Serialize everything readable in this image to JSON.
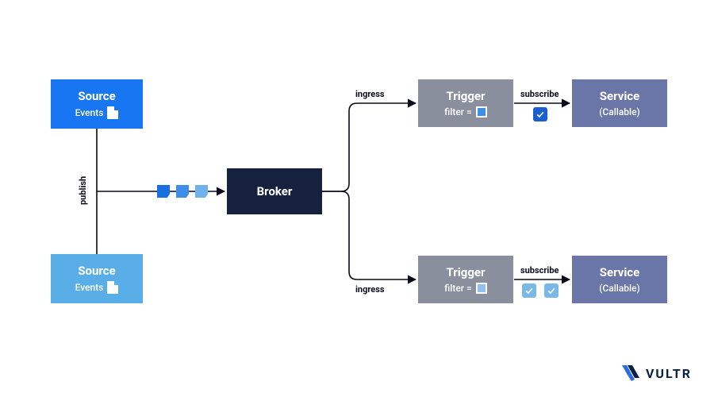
{
  "nodes": {
    "source1": {
      "title": "Source",
      "sub": "Events"
    },
    "source2": {
      "title": "Source",
      "sub": "Events"
    },
    "broker": {
      "title": "Broker"
    },
    "trigger1": {
      "title": "Trigger",
      "sub": "filter ="
    },
    "trigger2": {
      "title": "Trigger",
      "sub": "filter ="
    },
    "service1": {
      "title": "Service",
      "sub": "(Callable)"
    },
    "service2": {
      "title": "Service",
      "sub": "(Callable)"
    }
  },
  "labels": {
    "publish": "publish",
    "ingress1": "ingress",
    "ingress2": "ingress",
    "subscribe1": "subscribe",
    "subscribe2": "subscribe"
  },
  "colors": {
    "sourceDark": "#1976f2",
    "sourceLight": "#5aaee8",
    "broker": "#16213e",
    "trigger": "#8a8f9e",
    "service": "#6b76a8",
    "packetDark": "#1a6fe0",
    "packetMid": "#3c8ee8",
    "packetLight": "#6fb1ea",
    "filterTop": "#3c8ee8",
    "filterBottom": "#8fc2ef",
    "checkBlue": "#1a5fd0",
    "checkLight": "#7ab8e8"
  },
  "logo": {
    "text": "VULTR"
  },
  "chart_data": {
    "type": "flow-diagram",
    "nodes": [
      {
        "id": "source1",
        "label": "Source",
        "sublabel": "Events",
        "kind": "source"
      },
      {
        "id": "source2",
        "label": "Source",
        "sublabel": "Events",
        "kind": "source"
      },
      {
        "id": "broker",
        "label": "Broker",
        "kind": "broker"
      },
      {
        "id": "trigger1",
        "label": "Trigger",
        "sublabel": "filter =",
        "kind": "trigger",
        "filterColor": "#3c8ee8"
      },
      {
        "id": "trigger2",
        "label": "Trigger",
        "sublabel": "filter =",
        "kind": "trigger",
        "filterColor": "#8fc2ef"
      },
      {
        "id": "service1",
        "label": "Service",
        "sublabel": "(Callable)",
        "kind": "service"
      },
      {
        "id": "service2",
        "label": "Service",
        "sublabel": "(Callable)",
        "kind": "service"
      }
    ],
    "edges": [
      {
        "from": "source1",
        "to": "broker",
        "label": "publish"
      },
      {
        "from": "source2",
        "to": "broker",
        "label": "publish"
      },
      {
        "from": "broker",
        "to": "trigger1",
        "label": "ingress"
      },
      {
        "from": "broker",
        "to": "trigger2",
        "label": "ingress"
      },
      {
        "from": "trigger1",
        "to": "service1",
        "label": "subscribe"
      },
      {
        "from": "trigger2",
        "to": "service2",
        "label": "subscribe"
      }
    ]
  }
}
